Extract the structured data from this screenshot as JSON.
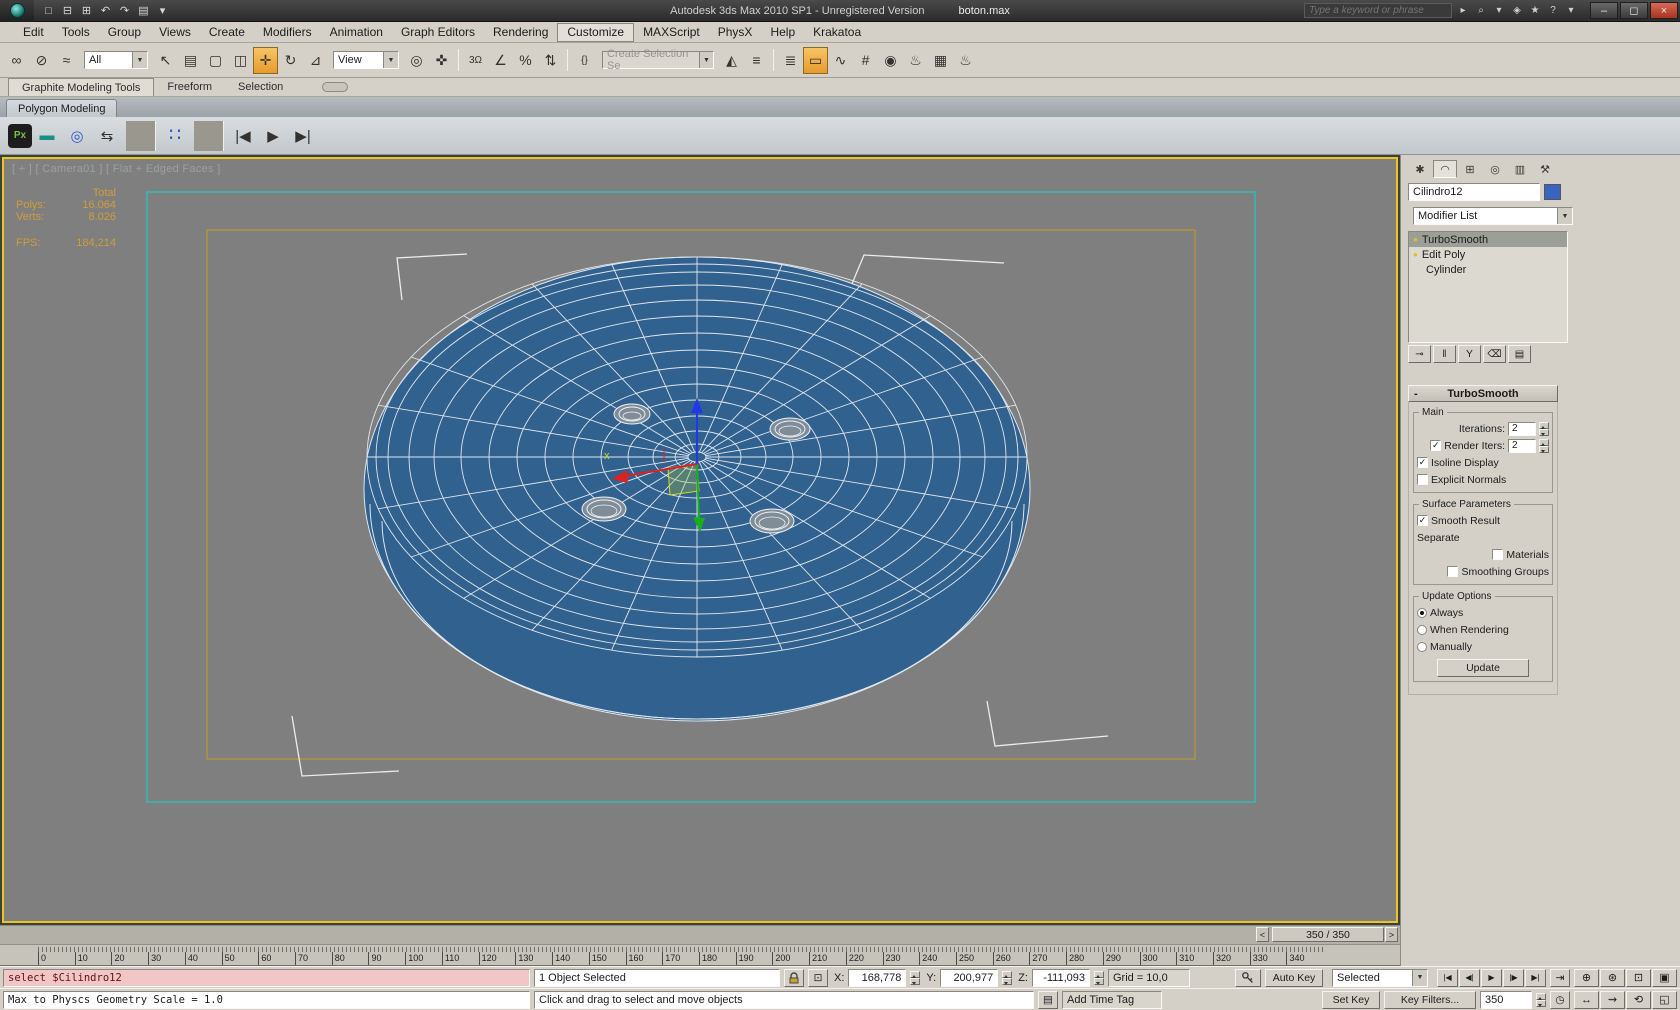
{
  "colors": {
    "accent_yellow_border": "#e8c81f",
    "viewport_background": "#7f7f7f",
    "object_blue": "#31618f",
    "safe_frame_teal": "#35b8b0",
    "safe_frame_orange": "#bf9730",
    "stats_orange": "#cf9d3a",
    "close_button_red": "#a8341f",
    "tool_highlight_orange": "#e89a2e"
  },
  "title_bar": {
    "app_title": "Autodesk 3ds Max 2010 SP1  - Unregistered Version",
    "file_name": "boton.max",
    "search_placeholder": "Type a keyword or phrase",
    "quick_access": [
      {
        "glyph": "□",
        "name": "new-scene-button"
      },
      {
        "glyph": "⊟",
        "name": "open-file-button"
      },
      {
        "glyph": "⊞",
        "name": "save-file-button"
      },
      {
        "glyph": "↶",
        "name": "undo-button"
      },
      {
        "glyph": "↷",
        "name": "redo-button"
      },
      {
        "glyph": "▤",
        "name": "project-folder-button"
      },
      {
        "glyph": "▾",
        "name": "quick-access-options-dropdown"
      }
    ],
    "info_icons": [
      {
        "glyph": "▸",
        "name": "infocenter-expand-icon"
      },
      {
        "glyph": "⌕",
        "name": "search-icon"
      },
      {
        "glyph": "▾",
        "name": "search-scope-dropdown"
      },
      {
        "glyph": "◈",
        "name": "communication-center-icon"
      },
      {
        "glyph": "★",
        "name": "favorites-star-icon"
      },
      {
        "glyph": "?",
        "name": "help-icon"
      },
      {
        "glyph": "▾",
        "name": "help-dropdown"
      }
    ],
    "window_controls": [
      {
        "glyph": "–",
        "name": "minimize-button"
      },
      {
        "glyph": "◻",
        "name": "maximize-button"
      },
      {
        "glyph": "×",
        "name": "close-button",
        "cls": "close"
      }
    ]
  },
  "menu_bar": {
    "items": [
      {
        "label": "Edit",
        "name": "menu-edit"
      },
      {
        "label": "Tools",
        "name": "menu-tools"
      },
      {
        "label": "Group",
        "name": "menu-group"
      },
      {
        "label": "Views",
        "name": "menu-views"
      },
      {
        "label": "Create",
        "name": "menu-create"
      },
      {
        "label": "Modifiers",
        "name": "menu-modifiers"
      },
      {
        "label": "Animation",
        "name": "menu-animation"
      },
      {
        "label": "Graph Editors",
        "name": "menu-graph-editors"
      },
      {
        "label": "Rendering",
        "name": "menu-rendering"
      },
      {
        "label": "Customize",
        "name": "menu-customize",
        "cls": "framed"
      },
      {
        "label": "MAXScript",
        "name": "menu-maxscript"
      },
      {
        "label": "PhysX",
        "name": "menu-physx"
      },
      {
        "label": "Help",
        "name": "menu-help"
      },
      {
        "label": "Krakatoa",
        "name": "menu-krakatoa"
      }
    ]
  },
  "toolbar": {
    "filter_value": "All",
    "coord_value": "View",
    "named_sel_value": "Create Selection Se",
    "group1": [
      {
        "glyph": "∞",
        "name": "select-and-link-button"
      },
      {
        "glyph": "⊘",
        "name": "unlink-selection-button"
      },
      {
        "glyph": "≈",
        "name": "bind-to-space-warp-button"
      }
    ],
    "group2": [
      {
        "glyph": "↖",
        "name": "select-object-button"
      },
      {
        "glyph": "▤",
        "name": "select-by-name-button"
      },
      {
        "glyph": "▢",
        "name": "rectangular-selection-region-button"
      },
      {
        "glyph": "◫",
        "name": "window-crossing-toggle"
      },
      {
        "glyph": "✛",
        "name": "select-and-move-button",
        "cls": "active-tool"
      },
      {
        "glyph": "↻",
        "name": "select-and-rotate-button"
      },
      {
        "glyph": "⊿",
        "name": "select-and-scale-button"
      }
    ],
    "group3": [
      {
        "glyph": "◎",
        "name": "use-pivot-point-button"
      },
      {
        "glyph": "✜",
        "name": "select-and-manipulate-button"
      },
      {
        "glyph": "",
        "name": "separator",
        "cls": "vsep"
      },
      {
        "glyph": "3Ω",
        "name": "snaps-toggle",
        "cls": "sm"
      },
      {
        "glyph": "∠",
        "name": "angle-snap-toggle"
      },
      {
        "glyph": "%",
        "name": "percent-snap-toggle"
      },
      {
        "glyph": "⇅",
        "name": "spinner-snap-toggle"
      },
      {
        "glyph": "",
        "name": "separator",
        "cls": "vsep"
      },
      {
        "glyph": "{}",
        "name": "edit-named-selection-sets-button",
        "cls": "sm"
      }
    ],
    "group4": [
      {
        "glyph": "◭",
        "name": "mirror-button"
      },
      {
        "glyph": "≡",
        "name": "align-button"
      },
      {
        "glyph": "",
        "name": "separator",
        "cls": "vsep"
      },
      {
        "glyph": "≣",
        "name": "layer-manager-button"
      },
      {
        "glyph": "▭",
        "name": "graphite-ribbon-toggle",
        "cls": "active-tool"
      },
      {
        "glyph": "∿",
        "name": "curve-editor-button"
      },
      {
        "glyph": "#",
        "name": "schematic-view-button"
      },
      {
        "glyph": "◉",
        "name": "material-editor-button"
      },
      {
        "glyph": "♨",
        "name": "render-setup-button"
      },
      {
        "glyph": "▦",
        "name": "rendered-frame-window-button"
      },
      {
        "glyph": "♨",
        "name": "render-production-button"
      }
    ]
  },
  "ribbon": {
    "tabs": [
      {
        "label": "Graphite Modeling Tools",
        "name": "tab-graphite-modeling-tools",
        "cls": "active"
      },
      {
        "label": "Freeform",
        "name": "tab-freeform"
      },
      {
        "label": "Selection",
        "name": "tab-selection"
      }
    ],
    "panel_tab": "Polygon Modeling",
    "tools": [
      {
        "glyph": "Px",
        "name": "physx-logo-icon",
        "cls": "physx"
      },
      {
        "glyph": "▬",
        "name": "rigid-body-icon",
        "cls": "teal"
      },
      {
        "glyph": "◎",
        "name": "ragdoll-icon",
        "cls": "blue"
      },
      {
        "glyph": "⇆",
        "name": "physx-constraints-icon"
      },
      {
        "glyph": "",
        "name": "separator",
        "cls": "vsep"
      },
      {
        "glyph": "∷",
        "name": "simulation-objects-icon",
        "cls": "blue big"
      },
      {
        "glyph": "",
        "name": "separator",
        "cls": "vsep"
      },
      {
        "glyph": "|◀",
        "name": "simulation-reset-button"
      },
      {
        "glyph": "▶",
        "name": "simulation-play-button"
      },
      {
        "glyph": "▶|",
        "name": "simulation-step-button"
      }
    ]
  },
  "viewport": {
    "label": "[ + ] [ Camera01 ] [ Flat + Edged Faces ]",
    "stats": {
      "total_label": "Total",
      "polys_label": "Polys:",
      "polys_value": "16.064",
      "verts_label": "Verts:",
      "verts_value": "8.026",
      "fps_label": "FPS:",
      "fps_value": "184,214"
    }
  },
  "command_panel": {
    "tabs": [
      {
        "glyph": "✱",
        "name": "tab-create"
      },
      {
        "glyph": "◠",
        "name": "tab-modify",
        "cls": "active"
      },
      {
        "glyph": "⊞",
        "name": "tab-hierarchy"
      },
      {
        "glyph": "◎",
        "name": "tab-motion"
      },
      {
        "glyph": "▥",
        "name": "tab-display"
      },
      {
        "glyph": "⚒",
        "name": "tab-utilities"
      }
    ],
    "object_name": "Cilindro12",
    "modifier_list_label": "Modifier List",
    "stack": [
      {
        "label": "TurboSmooth",
        "name": "stack-turbosmooth",
        "cls": "selected bulb"
      },
      {
        "label": "Edit Poly",
        "name": "stack-edit-poly",
        "cls": "bulb"
      },
      {
        "label": "Cylinder",
        "name": "stack-cylinder",
        "cls": "base"
      }
    ],
    "stack_buttons": [
      {
        "glyph": "⊸",
        "name": "pin-stack-button"
      },
      {
        "glyph": "‖",
        "name": "show-end-result-button"
      },
      {
        "glyph": "Y",
        "name": "make-unique-button"
      },
      {
        "glyph": "⌫",
        "name": "remove-modifier-button"
      },
      {
        "glyph": "▤",
        "name": "configure-modifier-sets-button"
      }
    ],
    "rollout": {
      "title": "TurboSmooth",
      "main_group": "Main",
      "iterations_label": "Iterations:",
      "iterations_value": "2",
      "render_iters_label": "Render Iters:",
      "render_iters_value": "2",
      "isoline_label": "Isoline Display",
      "explicit_label": "Explicit Normals",
      "surface_group": "Surface Parameters",
      "smooth_result_label": "Smooth Result",
      "separate_label": "Separate",
      "materials_label": "Materials",
      "smoothing_label": "Smoothing Groups",
      "update_group": "Update Options",
      "always_label": "Always",
      "when_rendering_label": "When Rendering",
      "manually_label": "Manually",
      "update_button": "Update",
      "states": {
        "render_iters": true,
        "isoline": true,
        "explicit": false,
        "smooth_result": true,
        "materials": false,
        "smoothing": false,
        "update_always": true,
        "update_when": false,
        "update_manually": false
      }
    }
  },
  "timeline": {
    "slider_value": "350 / 350",
    "slider_prev": "<",
    "slider_next": ">",
    "ticks": [
      "0",
      "10",
      "20",
      "30",
      "40",
      "50",
      "60",
      "70",
      "80",
      "90",
      "100",
      "110",
      "120",
      "130",
      "140",
      "150",
      "160",
      "170",
      "180",
      "190",
      "200",
      "210",
      "220",
      "230",
      "240",
      "250",
      "260",
      "270",
      "280",
      "290",
      "300",
      "310",
      "320",
      "330",
      "340"
    ]
  },
  "status_bar": {
    "maxscript_line": "select $Cilindro12",
    "listener_line": "Max to Physcs Geometry Scale = 1.0",
    "selection_info": "1 Object Selected",
    "prompt": "Click and drag to select and move objects",
    "x_label": "X:",
    "x_value": "168,778",
    "y_label": "Y:",
    "y_value": "200,977",
    "z_label": "Z:",
    "z_value": "-111,093",
    "grid_text": "Grid = 10,0",
    "add_time_tag": "Add Time Tag",
    "auto_key": "Auto Key",
    "set_key": "Set Key",
    "selection_set": "Selected",
    "key_filters": "Key Filters...",
    "frame_value": "350",
    "time_controls": [
      {
        "glyph": "|◀",
        "name": "go-to-start-button"
      },
      {
        "glyph": "◀|",
        "name": "previous-frame-button"
      },
      {
        "glyph": "▶",
        "name": "play-animation-button"
      },
      {
        "glyph": "|▶",
        "name": "next-frame-button"
      },
      {
        "glyph": "▶|",
        "name": "go-to-end-button"
      }
    ],
    "nav_row1": [
      {
        "glyph": "⊕",
        "name": "zoom-button"
      },
      {
        "glyph": "⊛",
        "name": "zoom-all-button"
      },
      {
        "glyph": "⊡",
        "name": "zoom-extents-all-button"
      },
      {
        "glyph": "▣",
        "name": "zoom-region-button"
      }
    ],
    "nav_row2": [
      {
        "glyph": "↔",
        "name": "pan-button"
      },
      {
        "glyph": "⇝",
        "name": "walk-through-button"
      },
      {
        "glyph": "⟲",
        "name": "orbit-button"
      },
      {
        "glyph": "◱",
        "name": "maximize-viewport-button"
      }
    ]
  }
}
